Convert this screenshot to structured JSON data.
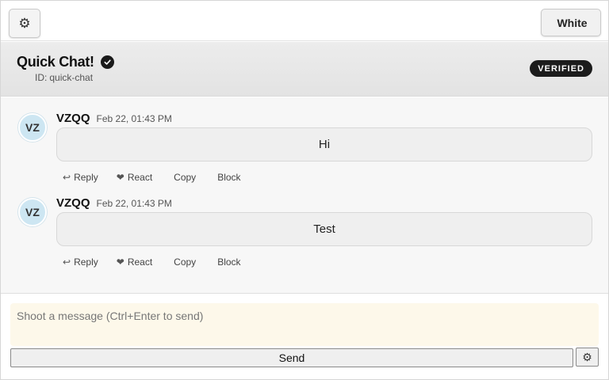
{
  "topbar": {
    "settings_icon": "⚙",
    "theme_glyph": "",
    "theme_label": "White"
  },
  "chat": {
    "title": "Quick Chat!",
    "id_label": "ID:",
    "id_value": "quick-chat",
    "badge": "VERIFIED"
  },
  "messages": [
    {
      "avatar": "VZ",
      "user": "VZQQ",
      "time": "Feb 22, 01:43 PM",
      "text": "Hi",
      "actions": [
        {
          "icon": "↩",
          "label": "Reply"
        },
        {
          "icon": "❤",
          "label": "React"
        },
        {
          "icon": "",
          "label": "Copy"
        },
        {
          "icon": "",
          "label": "Block"
        }
      ]
    },
    {
      "avatar": "VZ",
      "user": "VZQQ",
      "time": "Feb 22, 01:43 PM",
      "text": "Test",
      "actions": [
        {
          "icon": "↩",
          "label": "Reply"
        },
        {
          "icon": "❤",
          "label": "React"
        },
        {
          "icon": "",
          "label": "Copy"
        },
        {
          "icon": "",
          "label": "Block"
        }
      ]
    }
  ],
  "composer": {
    "placeholder": "Shoot a message (Ctrl+Enter to send)",
    "value": "",
    "send_label": "Send",
    "settings_icon": "⚙"
  },
  "colors": {
    "composer_bg": "#fdf8ea",
    "badge_bg": "#1c1c1c",
    "avatar_bg": "#cde6f2"
  }
}
